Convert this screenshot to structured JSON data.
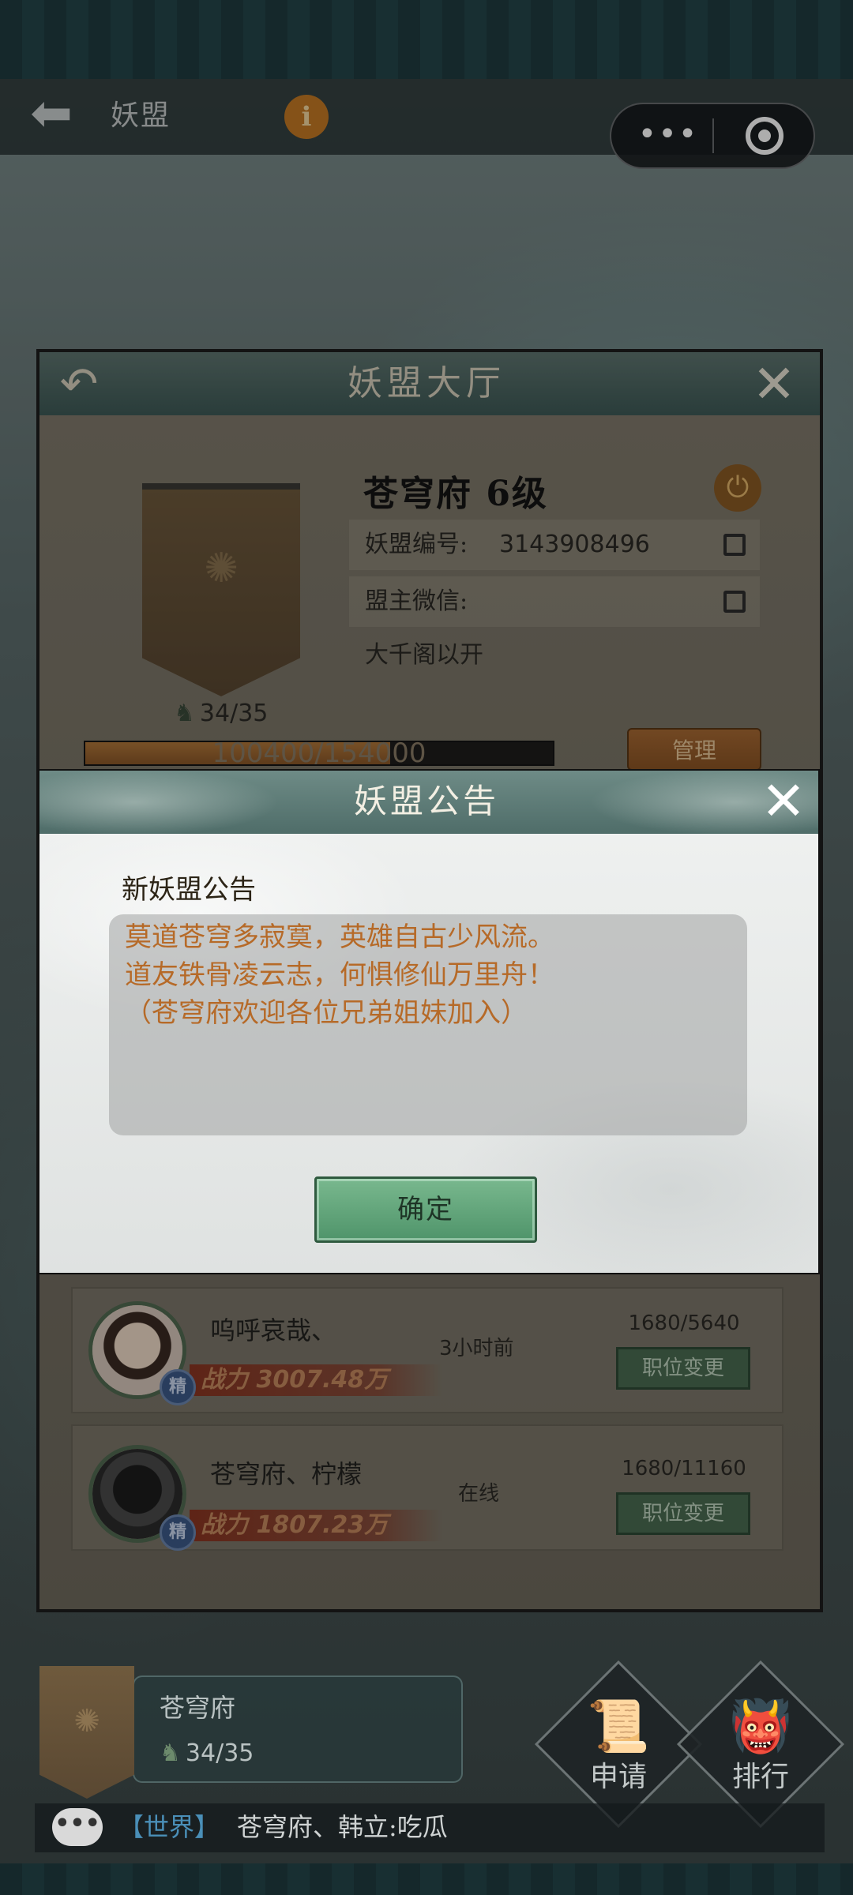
{
  "top_bar": {
    "title": "妖盟",
    "info_icon": "i",
    "capsule_menu_icon": "•••",
    "capsule_close_icon": "target-circle-icon"
  },
  "hall": {
    "title": "妖盟大厅",
    "guild_name": "苍穹府 6级",
    "member_count": "34/35",
    "id_label": "妖盟编号:",
    "id_value": "3143908496",
    "leader_wechat_label": "盟主微信:",
    "motto": "大千阁以开",
    "exp_text": "100400/154000",
    "exp_progress": 0.652,
    "manage_label": "管理",
    "members": [
      {
        "name": "呜呼哀哉、",
        "status": "3小时前",
        "contribution": "1680/5640",
        "power": "战力 3007.48万",
        "badge": "精",
        "role_button": "职位变更"
      },
      {
        "name": "苍穹府、柠檬",
        "status": "在线",
        "contribution": "1680/11160",
        "power": "战力 1807.23万",
        "badge": "精",
        "role_button": "职位变更"
      }
    ]
  },
  "modal": {
    "title": "妖盟公告",
    "heading": "新妖盟公告",
    "lines": [
      "莫道苍穹多寂寞，英雄自古少风流。",
      "道友铁骨凌云志，何惧修仙万里舟！",
      "（苍穹府欢迎各位兄弟姐妹加入）"
    ],
    "confirm_label": "确定"
  },
  "bottom": {
    "guild_name": "苍穹府",
    "member_count": "34/35",
    "apply_label": "申请",
    "rank_label": "排行",
    "chat_icon": "•••",
    "chat_channel": "【世界】",
    "chat_text": "苍穹府、韩立:吃瓜"
  },
  "colors": {
    "notice_text": "#b66a28",
    "confirm_button": "#5e9f76",
    "modal_header": "#5e7c78"
  }
}
